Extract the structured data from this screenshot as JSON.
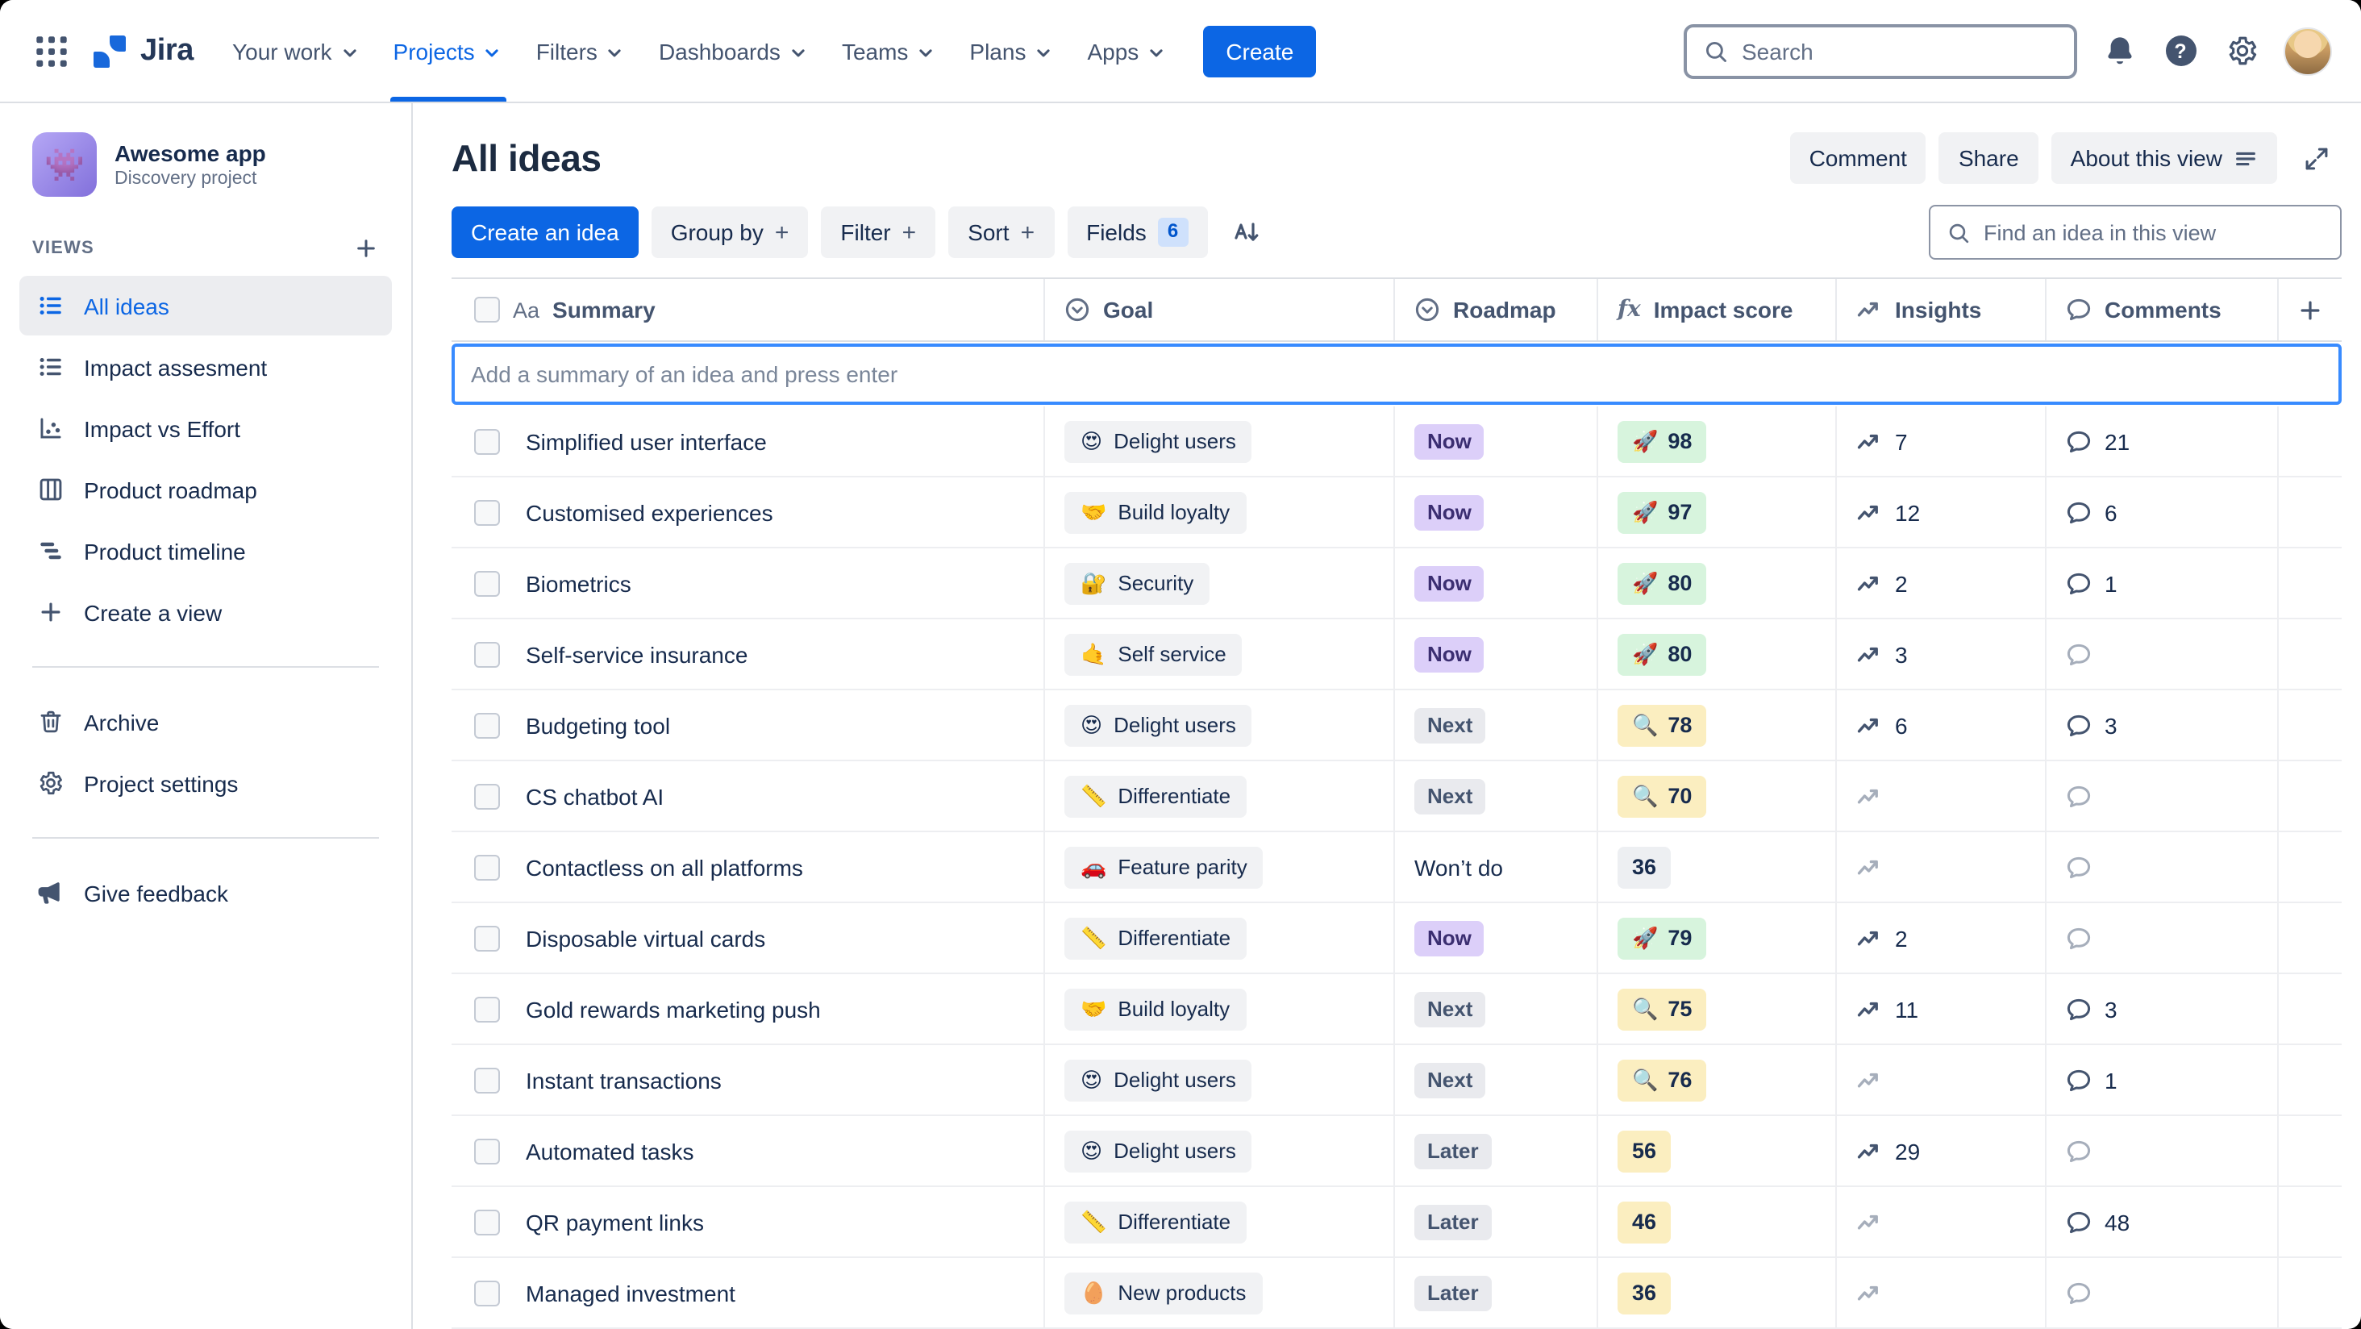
{
  "topnav": {
    "app_name": "Jira",
    "nav_items": [
      {
        "label": "Your work",
        "active": false
      },
      {
        "label": "Projects",
        "active": true
      },
      {
        "label": "Filters",
        "active": false
      },
      {
        "label": "Dashboards",
        "active": false
      },
      {
        "label": "Teams",
        "active": false
      },
      {
        "label": "Plans",
        "active": false
      },
      {
        "label": "Apps",
        "active": false
      }
    ],
    "create_label": "Create",
    "search_placeholder": "Search"
  },
  "sidebar": {
    "project_name": "Awesome app",
    "project_type": "Discovery project",
    "project_emoji": "👾",
    "views_heading": "VIEWS",
    "views": [
      {
        "label": "All ideas",
        "icon": "list",
        "selected": true
      },
      {
        "label": "Impact assesment",
        "icon": "list",
        "selected": false
      },
      {
        "label": "Impact vs Effort",
        "icon": "scatter",
        "selected": false
      },
      {
        "label": "Product roadmap",
        "icon": "board",
        "selected": false
      },
      {
        "label": "Product timeline",
        "icon": "timeline",
        "selected": false
      },
      {
        "label": "Create a view",
        "icon": "plus",
        "selected": false
      }
    ],
    "tools": [
      {
        "label": "Archive",
        "icon": "trash"
      },
      {
        "label": "Project settings",
        "icon": "gear"
      }
    ],
    "feedback_label": "Give feedback"
  },
  "header": {
    "title": "All ideas",
    "comment_label": "Comment",
    "share_label": "Share",
    "about_label": "About this view"
  },
  "toolbar": {
    "create_idea_label": "Create an idea",
    "group_by_label": "Group by",
    "filter_label": "Filter",
    "sort_label": "Sort",
    "fields_label": "Fields",
    "fields_count": "6",
    "find_placeholder": "Find an idea in this view"
  },
  "icons": {
    "plus": "+"
  },
  "table": {
    "add_placeholder": "Add a summary of an idea and press enter",
    "columns": [
      {
        "label": "Summary",
        "icon": "text"
      },
      {
        "label": "Goal",
        "icon": "select"
      },
      {
        "label": "Roadmap",
        "icon": "select"
      },
      {
        "label": "Impact score",
        "icon": "formula"
      },
      {
        "label": "Insights",
        "icon": "trend"
      },
      {
        "label": "Comments",
        "icon": "comment"
      }
    ],
    "rows": [
      {
        "summary": "Simplified user interface",
        "goal_emoji": "😍",
        "goal": "Delight users",
        "roadmap": "Now",
        "roadmap_color": "purple",
        "impact_emoji": "🚀",
        "impact": "98",
        "impact_color": "green",
        "insights": "7",
        "comments": "21"
      },
      {
        "summary": "Customised experiences",
        "goal_emoji": "🤝",
        "goal": "Build loyalty",
        "roadmap": "Now",
        "roadmap_color": "purple",
        "impact_emoji": "🚀",
        "impact": "97",
        "impact_color": "green",
        "insights": "12",
        "comments": "6"
      },
      {
        "summary": "Biometrics",
        "goal_emoji": "🔐",
        "goal": "Security",
        "roadmap": "Now",
        "roadmap_color": "purple",
        "impact_emoji": "🚀",
        "impact": "80",
        "impact_color": "green",
        "insights": "2",
        "comments": "1"
      },
      {
        "summary": "Self-service insurance",
        "goal_emoji": "🤙",
        "goal": "Self service",
        "roadmap": "Now",
        "roadmap_color": "purple",
        "impact_emoji": "🚀",
        "impact": "80",
        "impact_color": "green",
        "insights": "3",
        "comments": ""
      },
      {
        "summary": "Budgeting tool",
        "goal_emoji": "😍",
        "goal": "Delight users",
        "roadmap": "Next",
        "roadmap_color": "gray",
        "impact_emoji": "🔍",
        "impact": "78",
        "impact_color": "yellow",
        "insights": "6",
        "comments": "3"
      },
      {
        "summary": "CS chatbot AI",
        "goal_emoji": "📏",
        "goal": "Differentiate",
        "roadmap": "Next",
        "roadmap_color": "gray",
        "impact_emoji": "🔍",
        "impact": "70",
        "impact_color": "yellow",
        "insights": "",
        "comments": ""
      },
      {
        "summary": "Contactless on all platforms",
        "goal_emoji": "🚗",
        "goal": "Feature parity",
        "roadmap": "Won’t do",
        "roadmap_color": "none",
        "impact_emoji": "",
        "impact": "36",
        "impact_color": "gray",
        "insights": "",
        "comments": ""
      },
      {
        "summary": "Disposable virtual cards",
        "goal_emoji": "📏",
        "goal": "Differentiate",
        "roadmap": "Now",
        "roadmap_color": "purple",
        "impact_emoji": "🚀",
        "impact": "79",
        "impact_color": "green",
        "insights": "2",
        "comments": ""
      },
      {
        "summary": "Gold rewards marketing push",
        "goal_emoji": "🤝",
        "goal": "Build loyalty",
        "roadmap": "Next",
        "roadmap_color": "gray",
        "impact_emoji": "🔍",
        "impact": "75",
        "impact_color": "yellow",
        "insights": "11",
        "comments": "3"
      },
      {
        "summary": "Instant transactions",
        "goal_emoji": "😍",
        "goal": "Delight users",
        "roadmap": "Next",
        "roadmap_color": "gray",
        "impact_emoji": "🔍",
        "impact": "76",
        "impact_color": "yellow",
        "insights": "",
        "comments": "1"
      },
      {
        "summary": "Automated tasks",
        "goal_emoji": "😍",
        "goal": "Delight users",
        "roadmap": "Later",
        "roadmap_color": "gray",
        "impact_emoji": "",
        "impact": "56",
        "impact_color": "yellow",
        "insights": "29",
        "comments": ""
      },
      {
        "summary": "QR payment links",
        "goal_emoji": "📏",
        "goal": "Differentiate",
        "roadmap": "Later",
        "roadmap_color": "gray",
        "impact_emoji": "",
        "impact": "46",
        "impact_color": "yellow",
        "insights": "",
        "comments": "48"
      },
      {
        "summary": "Managed investment",
        "goal_emoji": "🥚",
        "goal": "New products",
        "roadmap": "Later",
        "roadmap_color": "gray",
        "impact_emoji": "",
        "impact": "36",
        "impact_color": "yellow",
        "insights": "",
        "comments": ""
      }
    ]
  },
  "colors": {
    "accent_blue": "#0C66E4",
    "lozenge_purple_bg": "#DCCFF9",
    "lozenge_gray_bg": "#E9EAEE",
    "score_green_bg": "#D7F4DD",
    "score_yellow_bg": "#FBEEC0",
    "score_gray_bg": "#EDEFF2"
  }
}
